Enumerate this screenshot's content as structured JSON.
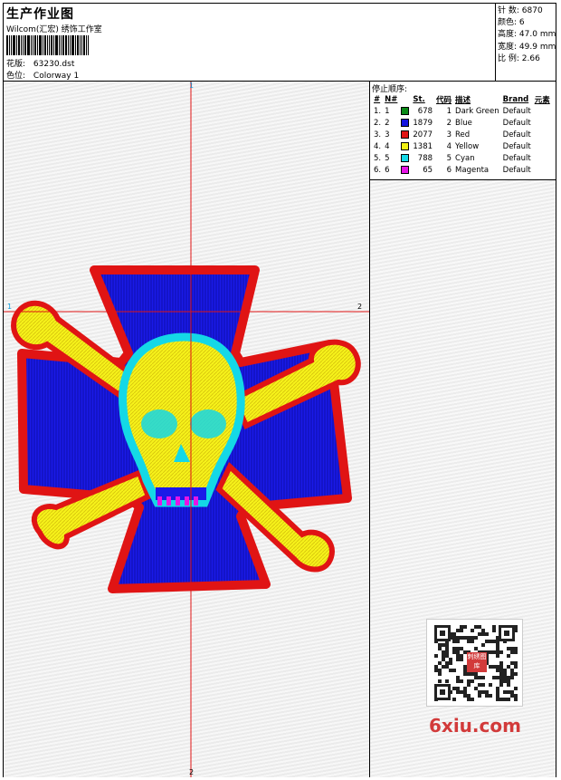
{
  "header": {
    "title": "生产作业图",
    "company": "Wilcom(汇宏) 绣饰工作室",
    "file_label": "花版:",
    "file_value": "63230.dst",
    "colorway_label": "色位:",
    "colorway_value": "Colorway 1"
  },
  "stats": [
    {
      "label": "针 数:",
      "value": "6870"
    },
    {
      "label": "颜色:",
      "value": "6"
    },
    {
      "label": "高度:",
      "value": "47.0 mm"
    },
    {
      "label": "宽度:",
      "value": "49.9 mm"
    },
    {
      "label": "比 例:",
      "value": "2.66"
    }
  ],
  "stop_sequence": {
    "title": "停止顺序:",
    "headers": [
      "#",
      "N#",
      "St.",
      "代码",
      "描述",
      "Brand",
      "元素"
    ],
    "rows": [
      {
        "idx": "1.",
        "n": "1",
        "color": "#0a8a17",
        "stitches": "678",
        "code": "1",
        "desc": "Dark Green",
        "brand": "Default"
      },
      {
        "idx": "2.",
        "n": "2",
        "color": "#1414e0",
        "stitches": "1879",
        "code": "2",
        "desc": "Blue",
        "brand": "Default"
      },
      {
        "idx": "3.",
        "n": "3",
        "color": "#e01414",
        "stitches": "2077",
        "code": "3",
        "desc": "Red",
        "brand": "Default"
      },
      {
        "idx": "4.",
        "n": "4",
        "color": "#f2f214",
        "stitches": "1381",
        "code": "4",
        "desc": "Yellow",
        "brand": "Default"
      },
      {
        "idx": "5.",
        "n": "5",
        "color": "#14d8e6",
        "stitches": "788",
        "code": "5",
        "desc": "Cyan",
        "brand": "Default"
      },
      {
        "idx": "6.",
        "n": "6",
        "color": "#e614e6",
        "stitches": "65",
        "code": "6",
        "desc": "Magenta",
        "brand": "Default"
      }
    ]
  },
  "axes": {
    "top": "1",
    "bottom": "2",
    "left": "1",
    "right": "2"
  },
  "watermark": "6xiu.com",
  "qr_stamp": "刺绣图库"
}
